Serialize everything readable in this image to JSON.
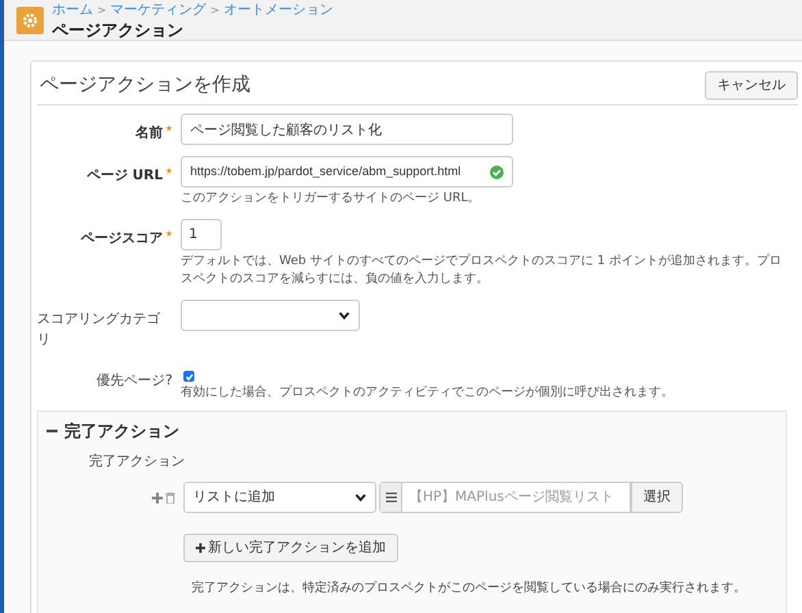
{
  "header": {
    "breadcrumbs": [
      "ホーム",
      "マーケティング",
      "オートメーション"
    ],
    "separator": ">",
    "title": "ページアクション"
  },
  "form": {
    "title": "ページアクションを作成",
    "cancel_button": "キャンセル",
    "fields": [
      {
        "kind": "text",
        "label": "名前",
        "required": true,
        "value": "ページ閲覧した顧客のリスト化"
      },
      {
        "kind": "url",
        "label": "ページ URL",
        "required": true,
        "value": "https://tobem.jp/pardot_service/abm_support.html",
        "valid": true,
        "help": "このアクションをトリガーするサイトのページ URL。"
      },
      {
        "kind": "number",
        "label": "ページスコア",
        "required": true,
        "value": "1",
        "help": "デフォルトでは、Web サイトのすべてのページでプロスペクトのスコアに 1 ポイントが追加されます。プロスペクトのスコアを減らすには、負の値を入力します。"
      },
      {
        "kind": "select",
        "label": "スコアリングカテゴリ",
        "required": false
      },
      {
        "kind": "checkbox",
        "label": "優先ページ?",
        "required": false,
        "checked": true,
        "help": "有効にした場合、プロスペクトのアクティビティでこのページが個別に呼び出されます。"
      }
    ]
  },
  "completion": {
    "title": "完了アクション",
    "expanded": true,
    "label": "完了アクション",
    "actions": [
      {
        "action": "リストに追加",
        "placeholder": "【HP】MAPlusページ閲覧リスト",
        "select_button": "選択"
      }
    ],
    "add_button": "新しい完了アクションを追加",
    "note": "完了アクションは、特定済みのプロスペクトがこのページを閲覧している場合にのみ実行されます。"
  }
}
